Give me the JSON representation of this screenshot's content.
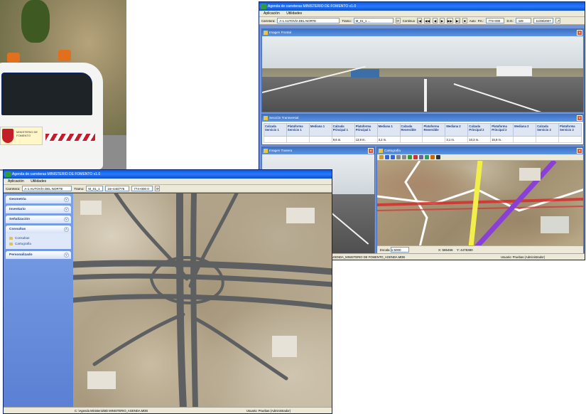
{
  "photo": {
    "logo_text": "MINISTERIO DE FOMENTO"
  },
  "main_window": {
    "title": "Agenda de carreteras  MINISTERIO DE FOMENTO  v1.0",
    "menu": [
      "Aplicación",
      "Utilidades"
    ],
    "toolbar": {
      "carretera_label": "Carretera:",
      "carretera_value": "A-1 AUTOVÍA DEL NORTE",
      "tramo_label": "Tramo:",
      "tramo_value": "M_01_1 ...",
      "continuo_label": "Continuo",
      "auto_label": "Auto",
      "pk_label": "P.K.:",
      "pk_value": "774+000",
      "dist_label": "D.O.:",
      "dist_value": "449",
      "date_value": "11/08/2007"
    },
    "frontal_image_title": "Imagen Frontal",
    "section_title": "Sección Transversal",
    "table_headers": [
      "Calzada Servicio 1",
      "Plataforma Servicio 1",
      "Mediana 1",
      "Calzada Principal 1",
      "Plataforma Principal 1",
      "Mediana 1",
      "Calzada Reversible",
      "Plataforma Reversible",
      "Mediana 2",
      "Calzada Principal 2",
      "Plataforma Principal 2",
      "Mediana 3",
      "Calzada Servicio 2",
      "Plataforma Servicio 2"
    ],
    "table_row": [
      "",
      "",
      "",
      "9,6 m.",
      "13,9 m.",
      "3,2 m.",
      "",
      "",
      "3,1 m.",
      "10,3 m.",
      "15,9 m.",
      "",
      "",
      ""
    ],
    "rear_image_title": "Imagen Trasera",
    "map_title": "Cartografía",
    "map_footer": {
      "scale_label": "Escala",
      "scale_value": "1:5000",
      "x_value": "X: 585466",
      "y_value": "Y: 4478380"
    },
    "status": {
      "left": "C: AGENDA_MINISTERIO DE FOMENTO_AGENDA.MDB",
      "right": "Usuario: Pruebas (Administrador)"
    }
  },
  "second_window": {
    "title": "Agenda de carreteras  MINISTERIO DE FOMENTO  v1.0",
    "menu": [
      "Aplicación",
      "Utilidades"
    ],
    "toolbar": {
      "carretera_label": "Carretera:",
      "carretera_value": "A-1 AUTOVÍA DEL NORTE",
      "tramo_label": "Tramo:",
      "tramo_value": "M_01_1",
      "pk_value": "16+440/775",
      "extra_value": "774+000 0"
    },
    "sidebar": [
      {
        "label": "Geometría"
      },
      {
        "label": "Inventario"
      },
      {
        "label": "Señalización"
      },
      {
        "label": "Consultas",
        "items": [
          "Consultas",
          "Cartografía"
        ]
      },
      {
        "label": "Personalizado"
      }
    ],
    "status": {
      "left": "C: \\Agenda Ministerio\\BD MINISTERIO_AGENDA.MDB",
      "right": "Usuario: Pruebas (Administrador)"
    }
  },
  "colors": {
    "titlebar": "#0a5be0",
    "panel_title": "#3a72c8",
    "sidebar": "#7ba2e7",
    "route_yellow": "#f3ef4a",
    "route_purple": "#8a3fd6",
    "route_red": "#d62d2d"
  }
}
